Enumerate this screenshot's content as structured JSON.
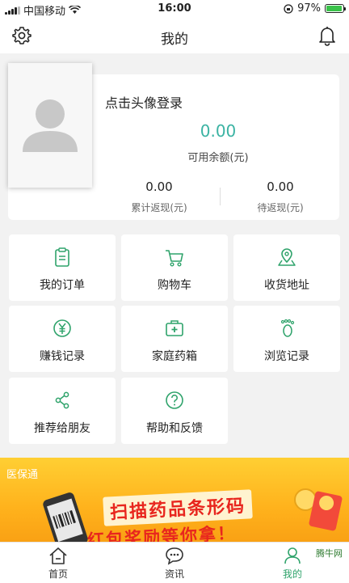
{
  "status_bar": {
    "carrier": "中国移动",
    "time": "16:00",
    "battery": "97%",
    "battery_level": 0.97
  },
  "header": {
    "title": "我的"
  },
  "profile": {
    "login_prompt": "点击头像登录",
    "balance_value": "0.00",
    "balance_label": "可用余额(元)",
    "stats": [
      {
        "value": "0.00",
        "label": "累计返现(元)"
      },
      {
        "value": "0.00",
        "label": "待返现(元)"
      }
    ]
  },
  "menu": {
    "items": [
      {
        "label": "我的订单",
        "icon": "order-icon"
      },
      {
        "label": "购物车",
        "icon": "cart-icon"
      },
      {
        "label": "收货地址",
        "icon": "location-icon"
      },
      {
        "label": "赚钱记录",
        "icon": "yen-icon"
      },
      {
        "label": "家庭药箱",
        "icon": "medicine-box-icon"
      },
      {
        "label": "浏览记录",
        "icon": "footprint-icon"
      },
      {
        "label": "推荐给朋友",
        "icon": "share-icon"
      },
      {
        "label": "帮助和反馈",
        "icon": "help-icon"
      }
    ]
  },
  "banner": {
    "tag": "医保通",
    "line1": "扫描药品条形码",
    "line2": "红包奖励等你拿！"
  },
  "tabbar": {
    "items": [
      {
        "label": "首页",
        "icon": "home-icon"
      },
      {
        "label": "资讯",
        "icon": "chat-icon"
      },
      {
        "label": "我的",
        "icon": "profile-icon"
      }
    ]
  },
  "watermark": "腾牛网",
  "colors": {
    "accent": "#3bb3a3",
    "icon_green": "#2fa36b",
    "banner": "#ffb21c",
    "banner_text": "#e8261e"
  }
}
